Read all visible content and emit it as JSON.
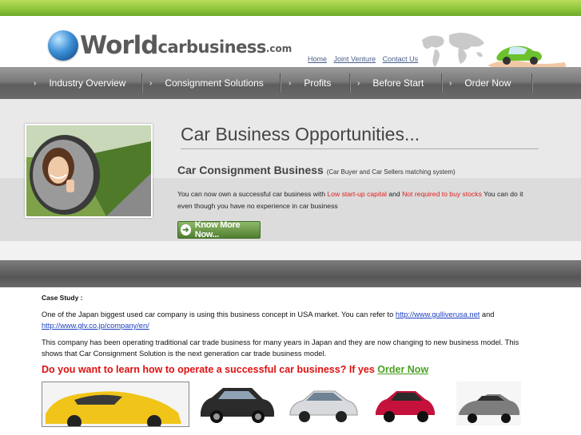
{
  "header": {
    "logo": {
      "world": "World",
      "car": "carbusiness",
      "com": ".com"
    },
    "links": [
      "Home",
      "Joint Venture",
      "Contact Us"
    ]
  },
  "nav": {
    "items": [
      "Industry Overview",
      "Consignment Solutions",
      "Profits",
      "Before Start",
      "Order Now"
    ]
  },
  "hero": {
    "title": "Car Business Opportunities...",
    "subtitle": "Car Consignment Business",
    "subtitle_note": "(Car Buyer and Car Sellers matching system)",
    "text_part1": "You can now own a successful car business with ",
    "text_red1": "Low start-up capital",
    "text_part2": " and ",
    "text_red2": "Not required to buy stocks",
    "text_part3": " You can do it even though you have no experience in car business",
    "button_label": "Know More Now..."
  },
  "case_study": {
    "label": "Case Study :",
    "para1_text": "One of the Japan biggest used car company is using this business concept in USA market. You can refer to ",
    "link1": "http://www.gulliverusa.net",
    "para1_and": " and",
    "link2": "http://www.glv.co.jp/company/en/",
    "para2": "This company has been operating traditional car trade business for many years in Japan and they are now changing to new business model. This shows that Car Consignment Solution is the next generation car trade business model.",
    "cta_text": "Do you want to learn how to operate a successful car business? If yes ",
    "cta_link": "Order Now"
  },
  "colors": {
    "accent_green": "#8cc43a",
    "nav_gray": "#6a6a6a",
    "highlight_red": "#e02020",
    "link_blue": "#1a3fbf",
    "cta_green": "#4aa020"
  }
}
